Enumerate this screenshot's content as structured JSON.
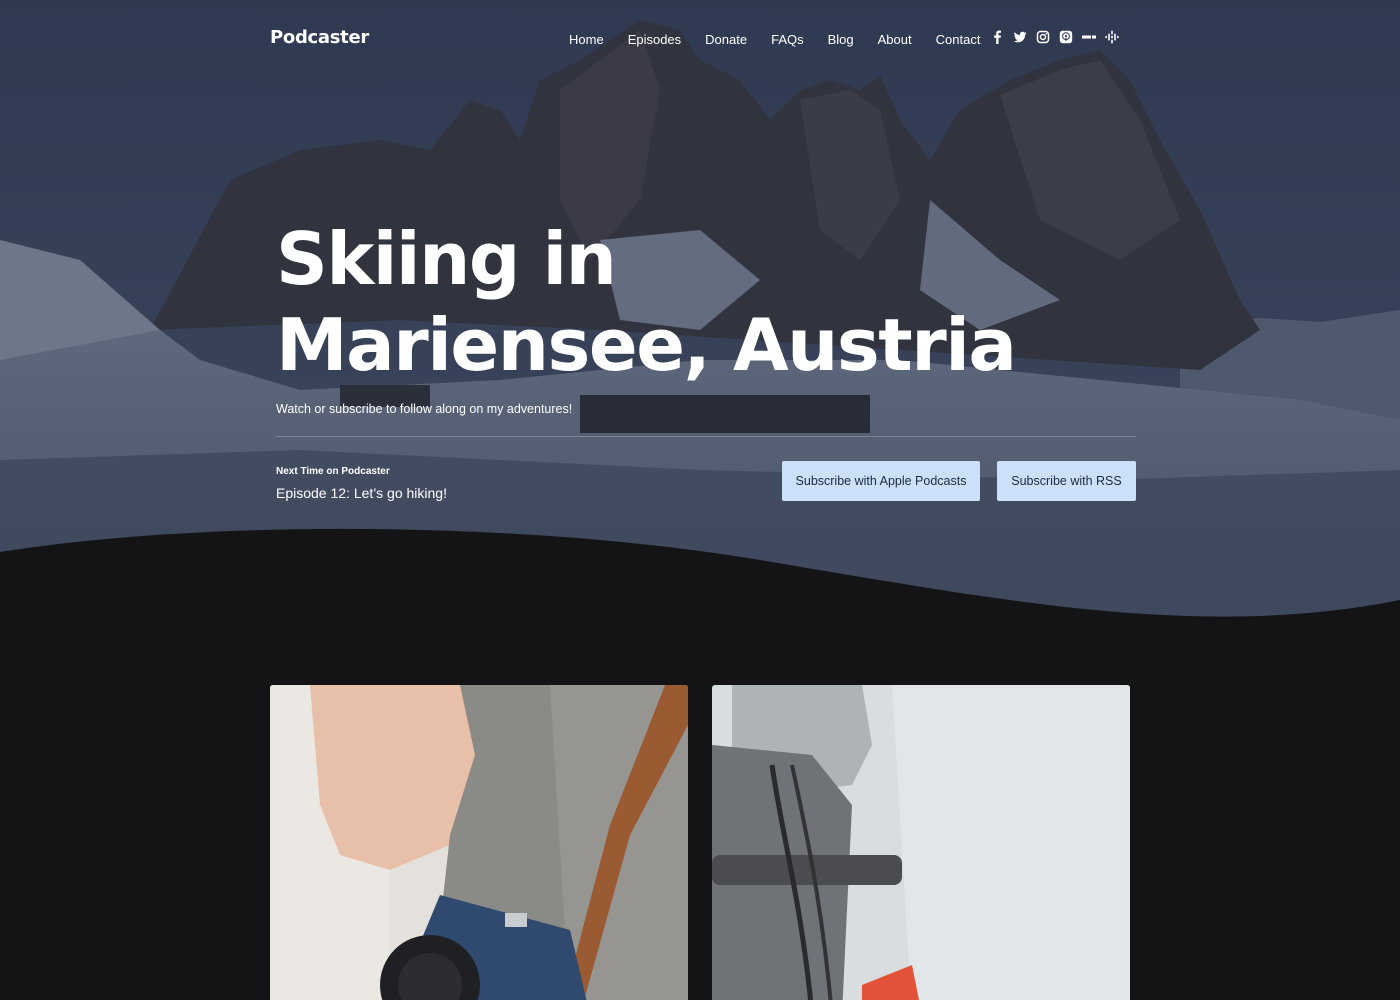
{
  "brand": "Podcaster",
  "nav": {
    "items": [
      "Home",
      "Episodes",
      "Donate",
      "FAQs",
      "Blog",
      "About",
      "Contact"
    ]
  },
  "social": [
    "facebook-icon",
    "twitter-icon",
    "instagram-icon",
    "apple-podcasts-icon",
    "spotify-icon",
    "google-podcasts-icon"
  ],
  "hero": {
    "title_line1": "Skiing in",
    "title_line2": "Mariensee, Austria",
    "subtitle": "Watch or subscribe to follow along on my adventures!",
    "next_label": "Next Time on Podcaster",
    "next_episode": "Episode 12: Let’s go hiking!",
    "buttons": {
      "apple": "Subscribe with Apple Podcasts",
      "rss": "Subscribe with RSS"
    }
  },
  "colors": {
    "page_bg": "#141416",
    "button_bg": "#cde0f9",
    "button_text": "#1b2a3f"
  }
}
